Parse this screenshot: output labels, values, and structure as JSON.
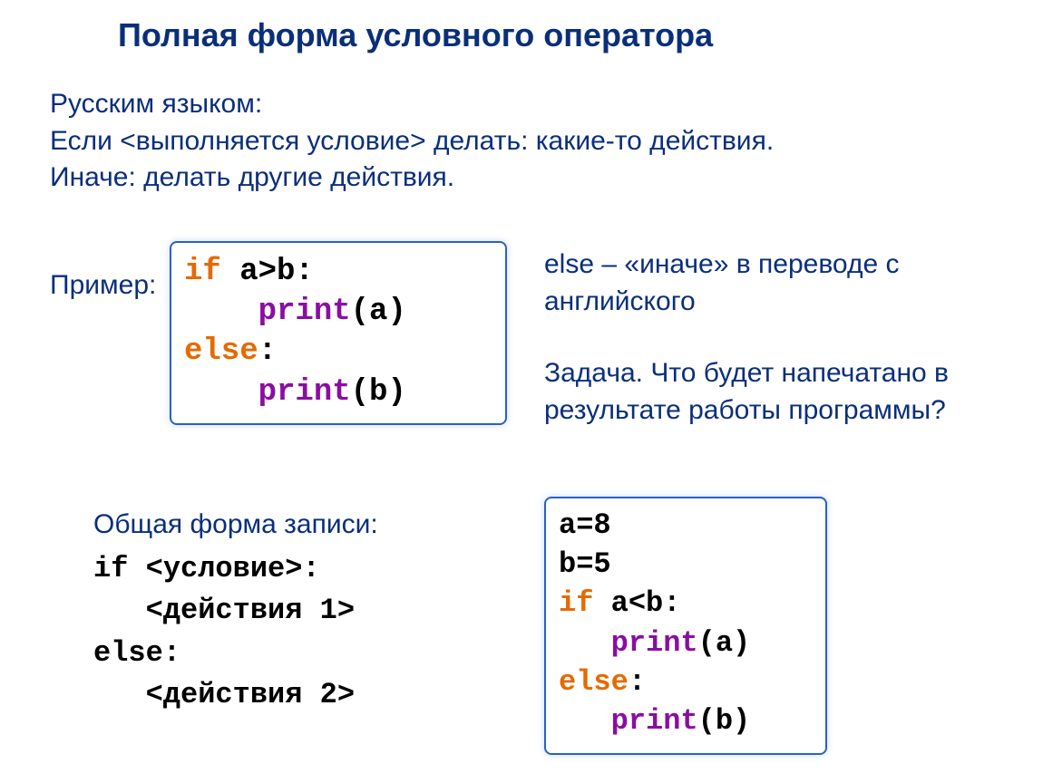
{
  "title": "Полная форма условного оператора",
  "intro_line1": "Русским языком:",
  "intro_line2": "Если <выполняется условие> делать: какие-то действия.",
  "intro_line3": "Иначе: делать другие действия.",
  "example_label": "Пример:",
  "code1": {
    "l1_if": "if ",
    "l1_cond": "a>b:",
    "l2_indent": "    ",
    "l2_print": "print",
    "l2_arg": "(a)",
    "l3_else": "else",
    "l3_colon": ":",
    "l4_indent": "    ",
    "l4_print": "print",
    "l4_arg": "(b)"
  },
  "right_note": "else – «иначе» в переводе с английского",
  "right_task": "Задача. Что будет напечатано в результате работы программы?",
  "form_label": "Общая форма записи:",
  "form_code": "if <условие>:\n   <действия 1>\nelse:\n   <действия 2>",
  "code2": {
    "l1": "a=8",
    "l2": "b=5",
    "l3_if": "if ",
    "l3_cond": "a<b:",
    "l4_indent": "   ",
    "l4_print": "print",
    "l4_arg": "(a)",
    "l5_else": "else",
    "l5_colon": ":",
    "l6_indent": "   ",
    "l6_print": "print",
    "l6_arg": "(b)"
  }
}
